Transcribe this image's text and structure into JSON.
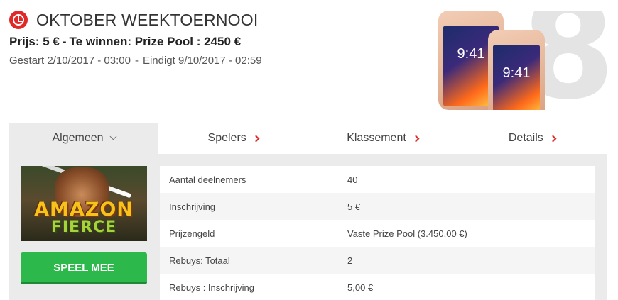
{
  "header": {
    "title": "OKTOBER WEEKTOERNOOI",
    "price_text": "Prijs: 5 €",
    "separator": "-",
    "prize_text": "Te winnen: Prize Pool : 2450 €",
    "started_text": "Gestart 2/10/2017 - 03:00",
    "ended_text": "Eindigt 9/10/2017 - 02:59"
  },
  "promo": {
    "number": "8",
    "phone_time_back": "9:41",
    "phone_time_front": "9:41"
  },
  "tabs": [
    {
      "label": "Algemeen",
      "active": true,
      "icon": "chevron-down-icon"
    },
    {
      "label": "Spelers",
      "active": false,
      "icon": "chevron-right-icon"
    },
    {
      "label": "Klassement",
      "active": false,
      "icon": "chevron-right-icon"
    },
    {
      "label": "Details",
      "active": false,
      "icon": "chevron-right-icon"
    }
  ],
  "game": {
    "logo_line1": "AMAZON",
    "logo_line2": "FIERCE",
    "play_label": "SPEEL MEE"
  },
  "info": [
    {
      "label": "Aantal deelnemers",
      "value": "40"
    },
    {
      "label": "Inschrijving",
      "value": "5 €"
    },
    {
      "label": "Prijzengeld",
      "value": "Vaste Prize Pool (3.450,00 €)"
    },
    {
      "label": "Rebuys: Totaal",
      "value": "2"
    },
    {
      "label": "Rebuys : Inschrijving",
      "value": "5,00 €"
    }
  ],
  "colors": {
    "accent_red": "#e02a2a",
    "play_green": "#2db84b",
    "panel_gray": "#ebebeb"
  }
}
